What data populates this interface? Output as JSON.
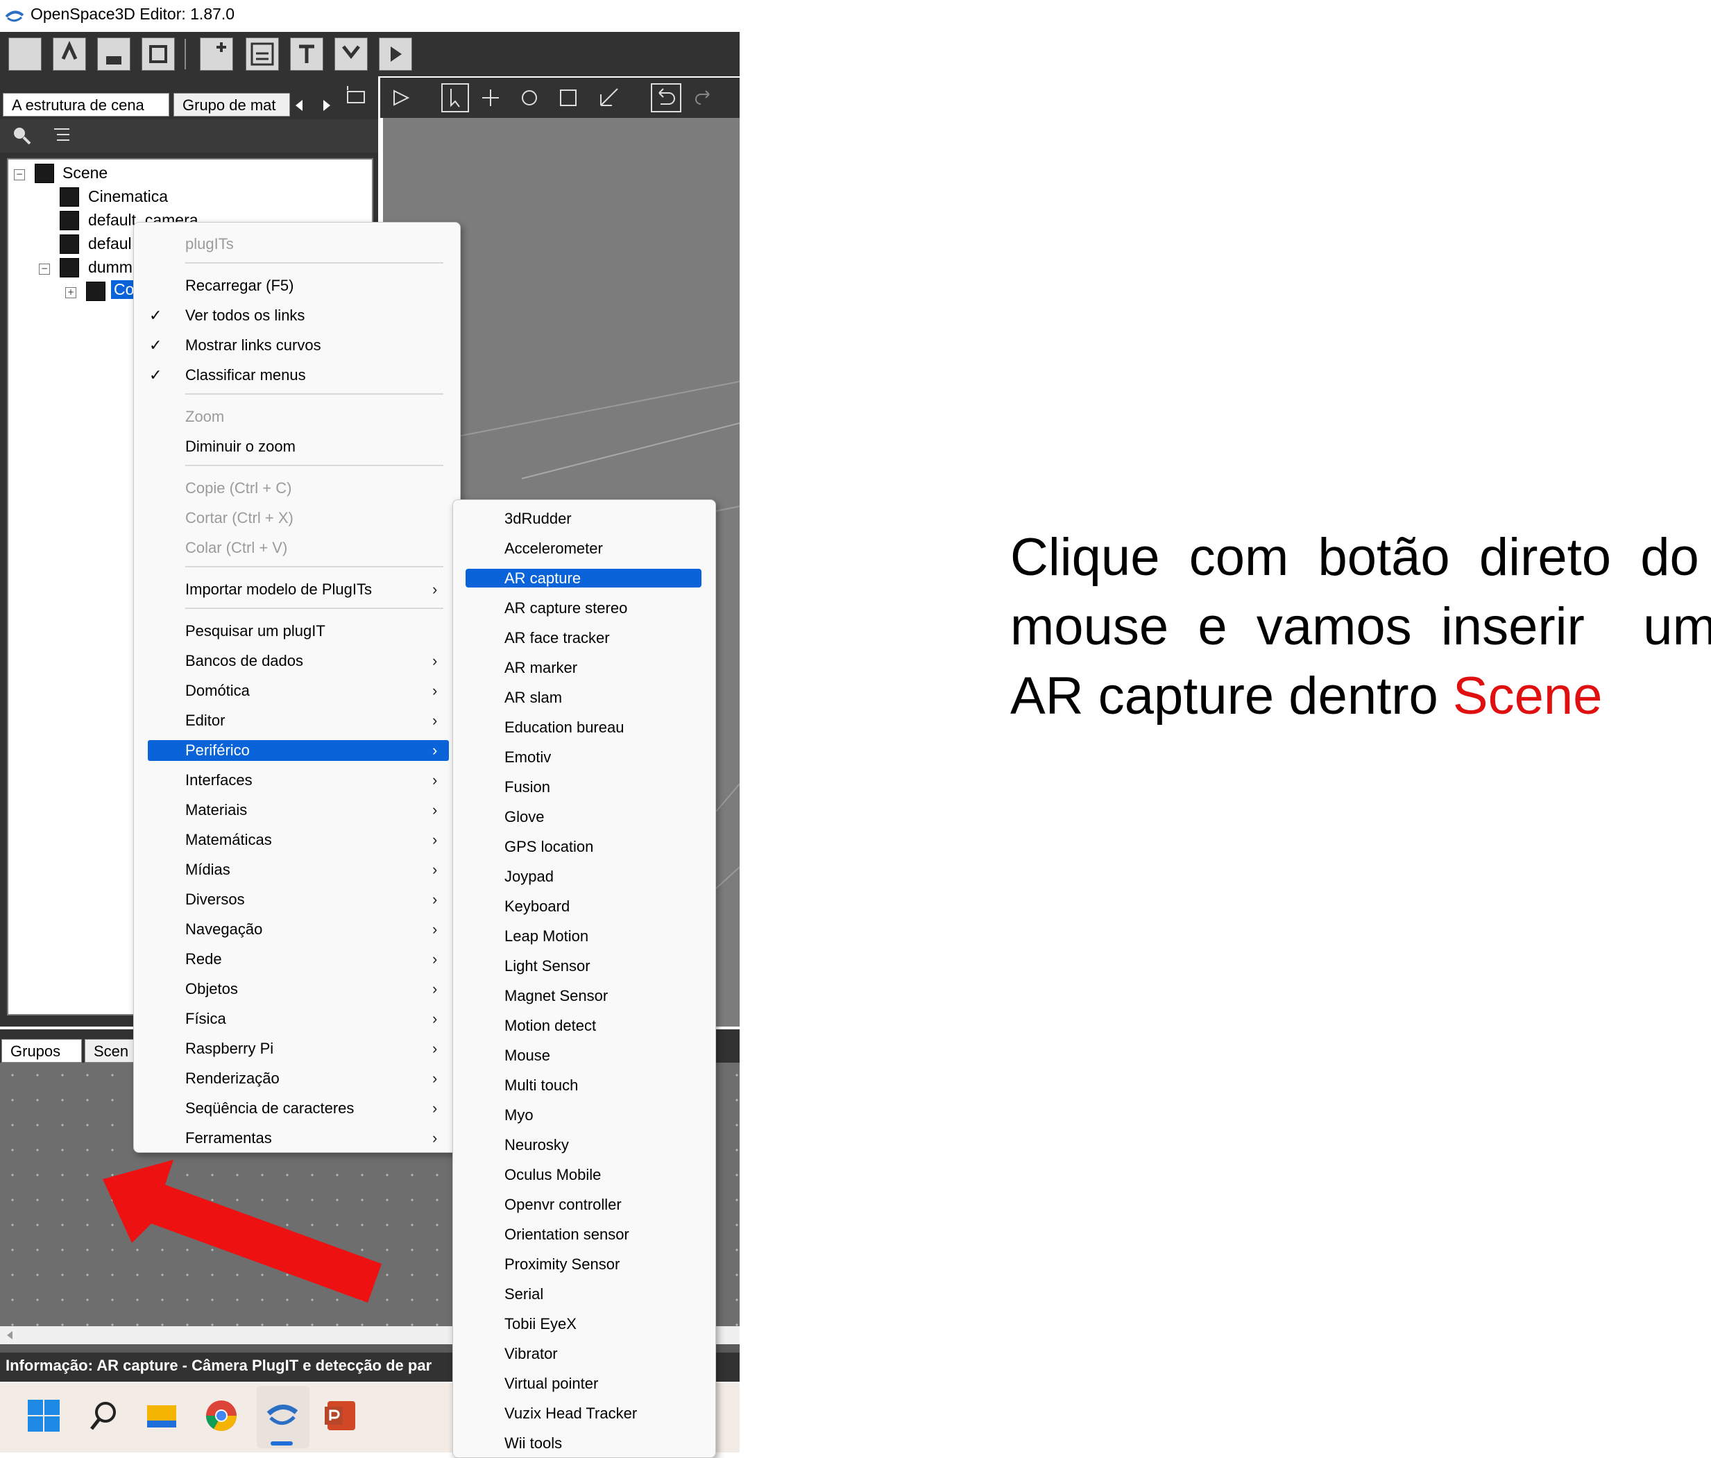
{
  "window": {
    "title": "OpenSpace3D Editor: 1.87.0"
  },
  "left_tabs": [
    "A estrutura de cena",
    "Grupo de mat"
  ],
  "tree": {
    "items": [
      "Scene",
      "Cinematica",
      "default_camera",
      "defaul",
      "dumm",
      "Co"
    ]
  },
  "bottom_tabs": [
    "Grupos",
    "Scen"
  ],
  "info_bar": "Informação: AR capture - Câmera PlugIT e detecção de par",
  "context_menu": {
    "header": "plugITs",
    "items": [
      {
        "label": "Recarregar (F5)"
      },
      {
        "label": "Ver todos os links",
        "checked": true
      },
      {
        "label": "Mostrar links curvos",
        "checked": true
      },
      {
        "label": "Classificar menus",
        "checked": true
      },
      {
        "label": "Zoom",
        "disabled": true
      },
      {
        "label": "Diminuir o zoom"
      },
      {
        "label": "Copie (Ctrl + C)",
        "disabled": true
      },
      {
        "label": "Cortar (Ctrl + X)",
        "disabled": true
      },
      {
        "label": "Colar (Ctrl + V)",
        "disabled": true
      },
      {
        "label": "Importar modelo de PlugITs",
        "submenu": true
      },
      {
        "label": "Pesquisar um plugIT"
      },
      {
        "label": "Bancos de dados",
        "submenu": true
      },
      {
        "label": "Domótica",
        "submenu": true
      },
      {
        "label": "Editor",
        "submenu": true
      },
      {
        "label": "Periférico",
        "submenu": true,
        "highlighted": true
      },
      {
        "label": "Interfaces",
        "submenu": true
      },
      {
        "label": "Materiais",
        "submenu": true
      },
      {
        "label": "Matemáticas",
        "submenu": true
      },
      {
        "label": "Mídias",
        "submenu": true
      },
      {
        "label": "Diversos",
        "submenu": true
      },
      {
        "label": "Navegação",
        "submenu": true
      },
      {
        "label": "Rede",
        "submenu": true
      },
      {
        "label": "Objetos",
        "submenu": true
      },
      {
        "label": "Física",
        "submenu": true
      },
      {
        "label": "Raspberry Pi",
        "submenu": true
      },
      {
        "label": "Renderização",
        "submenu": true
      },
      {
        "label": "Seqüência de caracteres",
        "submenu": true
      },
      {
        "label": "Ferramentas",
        "submenu": true
      }
    ]
  },
  "submenu": {
    "items": [
      "3dRudder",
      "Accelerometer",
      "AR capture",
      "AR capture stereo",
      "AR face tracker",
      "AR marker",
      "AR slam",
      "Education bureau",
      "Emotiv",
      "Fusion",
      "Glove",
      "GPS location",
      "Joypad",
      "Keyboard",
      "Leap Motion",
      "Light Sensor",
      "Magnet Sensor",
      "Motion detect",
      "Mouse",
      "Multi touch",
      "Myo",
      "Neurosky",
      "Oculus Mobile",
      "Openvr controller",
      "Orientation sensor",
      "Proximity Sensor",
      "Serial",
      "Tobii EyeX",
      "Vibrator",
      "Virtual pointer",
      "Vuzix Head Tracker",
      "Wii tools"
    ],
    "highlighted": "AR capture"
  },
  "annotation": {
    "line1": "Clique  com  botão  direto  do",
    "line2": "mouse  e  vamos  inserir    um",
    "line3_prefix": "AR capture dentro ",
    "line3_highlight": "Scene",
    "highlight_color": "#e01010"
  },
  "colors": {
    "menu_highlight": "#0a63d8",
    "arrow": "#ee1111"
  },
  "icons": {
    "toolbar": [
      "new-file-icon",
      "open-folder-icon",
      "save-icon",
      "save-as-icon",
      "add-folder-icon",
      "calculator-icon",
      "text-tool-icon",
      "import-icon",
      "play-icon"
    ],
    "viewport_toolbar": [
      "play-icon",
      "select-cursor-icon",
      "move-icon",
      "rotate-icon",
      "scale-icon",
      "world-axis-icon",
      "undo-icon",
      "redo-icon"
    ],
    "taskbar": [
      "windows-start-icon",
      "search-icon",
      "file-explorer-icon",
      "chrome-icon",
      "openspace3d-icon",
      "powerpoint-icon"
    ]
  }
}
